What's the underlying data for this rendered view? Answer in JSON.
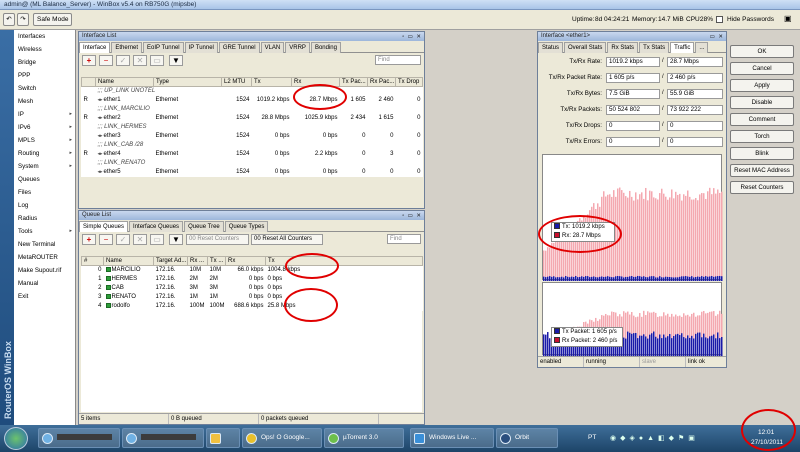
{
  "titlebar": {
    "title": "admin@ (ML Balance_Server) - WinBox v5.4 on RB750G (mipsbe)"
  },
  "toolbar": {
    "safe_mode": "Safe Mode",
    "uptime_label": "Uptime:",
    "uptime_value": "8d 04:24:21",
    "memory_label": "Memory:",
    "memory_value": "14.7 MiB",
    "cpu_label": "CPU:",
    "cpu_value": "28%",
    "hide_passwords": "Hide Passwords"
  },
  "sidebar": {
    "vertical_text": "RouterOS WinBox"
  },
  "menu": [
    {
      "label": "Interfaces",
      "arrow": false
    },
    {
      "label": "Wireless",
      "arrow": false
    },
    {
      "label": "Bridge",
      "arrow": false
    },
    {
      "label": "PPP",
      "arrow": false
    },
    {
      "label": "Switch",
      "arrow": false
    },
    {
      "label": "Mesh",
      "arrow": false
    },
    {
      "label": "IP",
      "arrow": true
    },
    {
      "label": "IPv6",
      "arrow": true
    },
    {
      "label": "MPLS",
      "arrow": true
    },
    {
      "label": "Routing",
      "arrow": true
    },
    {
      "label": "System",
      "arrow": true
    },
    {
      "label": "Queues",
      "arrow": false
    },
    {
      "label": "Files",
      "arrow": false
    },
    {
      "label": "Log",
      "arrow": false
    },
    {
      "label": "Radius",
      "arrow": false
    },
    {
      "label": "Tools",
      "arrow": true
    },
    {
      "label": "New Terminal",
      "arrow": false
    },
    {
      "label": "MetaROUTER",
      "arrow": false
    },
    {
      "label": "Make Supout.rif",
      "arrow": false
    },
    {
      "label": "Manual",
      "arrow": false
    },
    {
      "label": "Exit",
      "arrow": false
    }
  ],
  "interface_list": {
    "title": "Interface List",
    "tabs": [
      "Interface",
      "Ethernet",
      "EoIP Tunnel",
      "IP Tunnel",
      "GRE Tunnel",
      "VLAN",
      "VRRP",
      "Bonding"
    ],
    "find_placeholder": "Find",
    "columns": [
      "",
      "Name",
      "Type",
      "L2 MTU",
      "Tx",
      "Rx",
      "Tx Pac...",
      "Rx Pac...",
      "Tx Drop"
    ],
    "rows": [
      {
        "flag": "",
        "name": ";;; UP_LINK UNOTEL",
        "comment": true
      },
      {
        "flag": "R",
        "name": "ether1",
        "type": "Ethernet",
        "mtu": "1524",
        "tx": "1019.2 kbps",
        "rx": "28.7 Mbps",
        "txp": "1 605",
        "rxp": "2 460",
        "txd": "0"
      },
      {
        "flag": "",
        "name": ";;; LINK_MARCILIO",
        "comment": true
      },
      {
        "flag": "R",
        "name": "ether2",
        "type": "Ethernet",
        "mtu": "1524",
        "tx": "28.8 Mbps",
        "rx": "1025.9 kbps",
        "txp": "2 434",
        "rxp": "1 615",
        "txd": "0"
      },
      {
        "flag": "",
        "name": ";;; LINK_HERMES",
        "comment": true
      },
      {
        "flag": "",
        "name": "ether3",
        "type": "Ethernet",
        "mtu": "1524",
        "tx": "0 bps",
        "rx": "0 bps",
        "txp": "0",
        "rxp": "0",
        "txd": "0"
      },
      {
        "flag": "",
        "name": ";;; LINK_CAB /28",
        "comment": true
      },
      {
        "flag": "R",
        "name": "ether4",
        "type": "Ethernet",
        "mtu": "1524",
        "tx": "0 bps",
        "rx": "2.2 kbps",
        "txp": "0",
        "rxp": "3",
        "txd": "0"
      },
      {
        "flag": "",
        "name": ";;; LINK_RENATO",
        "comment": true
      },
      {
        "flag": "",
        "name": "ether5",
        "type": "Ethernet",
        "mtu": "1524",
        "tx": "0 bps",
        "rx": "0 bps",
        "txp": "0",
        "rxp": "0",
        "txd": "0"
      }
    ]
  },
  "queue_list": {
    "title": "Queue List",
    "tabs": [
      "Simple Queues",
      "Interface Queues",
      "Queue Tree",
      "Queue Types"
    ],
    "reset_counters": "Reset Counters",
    "reset_all_counters": "Reset All Counters",
    "find_placeholder": "Find",
    "columns": [
      "#",
      "Name",
      "Target Ad...",
      "Rx ...",
      "Tx ...",
      "Rx",
      "Tx"
    ],
    "rows": [
      {
        "num": "0",
        "name": "MARCILIO",
        "target": "172.16.",
        "rxl": "10M",
        "txl": "10M",
        "rx": "66.0 kbps",
        "tx": "1004.8 kbps"
      },
      {
        "num": "1",
        "name": "HERMES",
        "target": "172.16.",
        "rxl": "2M",
        "txl": "2M",
        "rx": "0 bps",
        "tx": "0 bps"
      },
      {
        "num": "2",
        "name": "CAB",
        "target": "172.16.",
        "rxl": "3M",
        "txl": "3M",
        "rx": "0 bps",
        "tx": "0 bps"
      },
      {
        "num": "3",
        "name": "RENATO",
        "target": "172.16.",
        "rxl": "1M",
        "txl": "1M",
        "rx": "0 bps",
        "tx": "0 bps"
      },
      {
        "num": "4",
        "name": "rodolfo",
        "target": "172.16.",
        "rxl": "100M",
        "txl": "100M",
        "rx": "688.6 kbps",
        "tx": "25.8 Mbps"
      }
    ],
    "status_items": "5 items",
    "status_queued_bytes": "0 B queued",
    "status_queued_packets": "0 packets queued"
  },
  "interface_detail": {
    "title": "Interface <ether1>",
    "tabs": [
      "Status",
      "Overall Stats",
      "Rx Stats",
      "Tx Stats",
      "Traffic",
      "..."
    ],
    "fields": [
      {
        "label": "Tx/Rx Rate:",
        "tx": "1019.2 kbps",
        "rx": "28.7 Mbps"
      },
      {
        "label": "Tx/Rx Packet Rate:",
        "tx": "1 605 p/s",
        "rx": "2 460 p/s"
      },
      {
        "label": "Tx/Rx Bytes:",
        "tx": "7.5 GiB",
        "rx": "55.9 GiB"
      },
      {
        "label": "Tx/Rx Packets:",
        "tx": "50 524 802",
        "rx": "73 922 222"
      },
      {
        "label": "Tx/Rx Drops:",
        "tx": "0",
        "rx": "0"
      },
      {
        "label": "Tx/Rx Errors:",
        "tx": "0",
        "rx": "0"
      }
    ],
    "legend_rate": [
      {
        "label": "Tx:",
        "value": "1019.2 kbps",
        "color": "#1a1aa8"
      },
      {
        "label": "Rx:",
        "value": "28.7 Mbps",
        "color": "#c8102e"
      }
    ],
    "legend_packets": [
      {
        "label": "Tx Packet:",
        "value": "1 605 p/s",
        "color": "#1a1aa8"
      },
      {
        "label": "Rx Packet:",
        "value": "2 460 p/s",
        "color": "#c8102e"
      }
    ],
    "status_enabled": "enabled",
    "status_running": "running",
    "status_slave": "slave",
    "status_link": "link ok"
  },
  "right_buttons": [
    "OK",
    "Cancel",
    "Apply",
    "Disable",
    "Comment",
    "Torch",
    "Blink",
    "Reset MAC Address",
    "Reset Counters"
  ],
  "taskbar": {
    "items": [
      "Ops! O Google...",
      "µTorrent 3.0",
      "Windows Live ...",
      "Orbit"
    ],
    "language": "PT",
    "time": "12:01",
    "date": "27/10/2011"
  },
  "colors": {
    "tx": "#1a1aa8",
    "rx": "#c8102e",
    "rx_fill": "#f4a8b0",
    "highlight": "#e00000"
  }
}
